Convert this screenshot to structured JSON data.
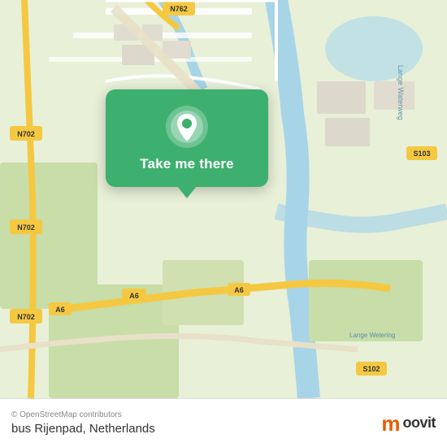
{
  "map": {
    "backgroundColor": "#e0ead0"
  },
  "popup": {
    "button_label": "Take me there",
    "bg_color": "#3daf6e"
  },
  "footer": {
    "copyright": "© OpenStreetMap contributors",
    "location": "bus Rijenpad, Netherlands",
    "logo_m": "m",
    "logo_text": "oovit"
  }
}
